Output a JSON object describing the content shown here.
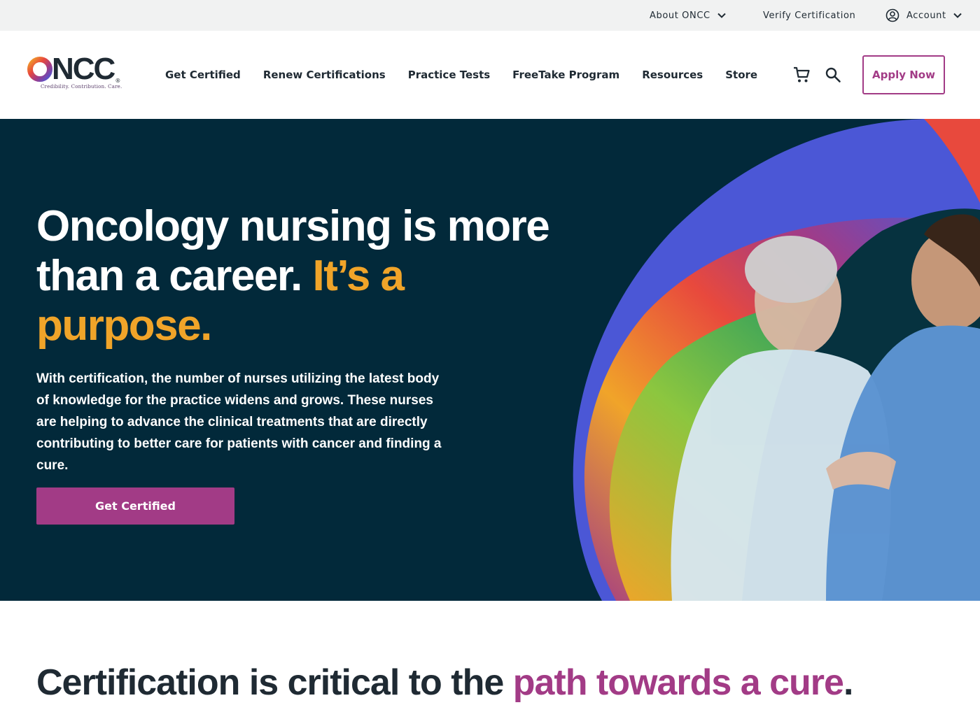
{
  "utility_bar": {
    "about_label": "About ONCC",
    "verify_label": "Verify Certification",
    "account_label": "Account"
  },
  "logo": {
    "wordmark": "ONCC",
    "registered": "®",
    "tagline": "Credibility. Contribution. Care."
  },
  "nav": {
    "items": [
      "Get Certified",
      "Renew Certifications",
      "Practice Tests",
      "FreeTake Program",
      "Resources",
      "Store"
    ],
    "apply_label": "Apply Now"
  },
  "hero": {
    "heading_white": "Oncology nursing is more than a career. ",
    "heading_accent": "It’s a purpose.",
    "body": "With certification, the number of nurses utilizing the latest body of knowledge for the practice widens and grows. These nurses are helping to advance the clinical treatments that are directly contributing to better care for patients with cancer and finding a cure.",
    "cta_label": "Get Certified"
  },
  "section": {
    "heading_dark": "Certification is critical to the ",
    "heading_accent": "path towards a cure",
    "heading_end": "."
  },
  "colors": {
    "brand_purple": "#a23b86",
    "hero_bg": "#02293a",
    "accent_gold": "#f0a429",
    "utility_bg": "#f1f2f2"
  }
}
